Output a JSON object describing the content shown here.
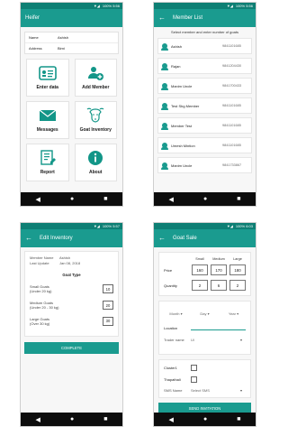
{
  "status": {
    "screen1": "100% 5:56",
    "screen2": "100% 5:56",
    "screen3": "100% 5:57",
    "screen4": "100% 6:03"
  },
  "screens": {
    "heifer": {
      "title": "Heifer",
      "info": [
        {
          "label": "Name",
          "value": "Ashish"
        },
        {
          "label": "Address",
          "value": "Birni"
        }
      ],
      "tiles": [
        {
          "label": "Enter data"
        },
        {
          "label": "Add Member"
        },
        {
          "label": "Messages"
        },
        {
          "label": "Goat Inventory"
        },
        {
          "label": "Report"
        },
        {
          "label": "About"
        }
      ]
    },
    "member_list": {
      "title": "Member List",
      "caption": "Select member and enter number of goats",
      "members": [
        {
          "name": "Ashish",
          "phone": "9841101685"
        },
        {
          "name": "Rajan",
          "phone": "9841204430"
        },
        {
          "name": "Manim Uncle",
          "phone": "9841700433"
        },
        {
          "name": "Test Sbg Member",
          "phone": "9841101685"
        },
        {
          "name": "Member Test",
          "phone": "9841101685"
        },
        {
          "name": "Umesh Mintion",
          "phone": "9841101685"
        },
        {
          "name": "Manim Uncle",
          "phone": "9841733867"
        }
      ]
    },
    "edit_inventory": {
      "title": "Edit Inventory",
      "member_name_label": "Member Name",
      "member_name_value": "Ashish",
      "last_update_label": "Last Update",
      "last_update_value": "Jan 08, 2018",
      "goat_type_label": "Goat Type",
      "rows": [
        {
          "name": "Small Goats",
          "range": "(Under 20 kg)",
          "value": "10"
        },
        {
          "name": "Medium Goats",
          "range": "(Under 20 - 30 kg)",
          "value": "20"
        },
        {
          "name": "Large Goats",
          "range": "(Over 30 kg)",
          "value": "30"
        }
      ],
      "complete_button": "COMPLETE"
    },
    "goat_sale": {
      "title": "Goat Sale",
      "size_headers": [
        "Small",
        "Medium",
        "Large"
      ],
      "price_label": "Price",
      "prices": [
        "160",
        "170",
        "180"
      ],
      "quantity_label": "Quantity",
      "quantities": [
        "2",
        "6",
        "2"
      ],
      "date_placeholders": [
        "Month",
        "Day",
        "Year"
      ],
      "location_label": "Location",
      "trader_label": "Trader name",
      "trader_value": "Ul",
      "cluster_label": "Cluster1",
      "thapathali_label": "Thapathali",
      "sms_label": "SMS Name",
      "sms_value": "Select SMS",
      "send_button": "SEND INVITATION"
    }
  },
  "nav": [
    "◀",
    "●",
    "■"
  ]
}
